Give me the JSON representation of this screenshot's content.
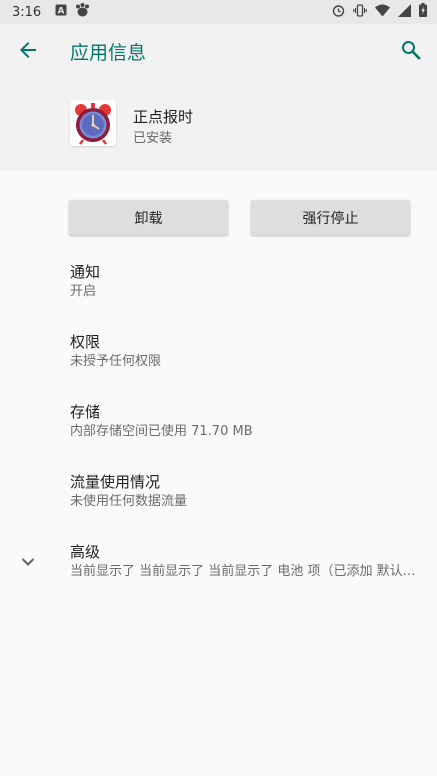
{
  "status_bar": {
    "time": "3:16",
    "left_icons": [
      "a-notification-icon",
      "paw-notification-icon"
    ],
    "right_icons": [
      "alarm-icon",
      "vibrate-icon",
      "wifi-icon",
      "signal-icon",
      "battery-icon"
    ]
  },
  "app_bar": {
    "title": "应用信息",
    "accent_color": "#00796b"
  },
  "app": {
    "name": "正点报时",
    "status": "已安装",
    "icon": "alarm-clock-icon"
  },
  "buttons": {
    "uninstall": "卸载",
    "force_stop": "强行停止"
  },
  "settings": [
    {
      "title": "通知",
      "summary": "开启"
    },
    {
      "title": "权限",
      "summary": "未授予任何权限"
    },
    {
      "title": "存储",
      "summary": "内部存储空间已使用 71.70 MB"
    },
    {
      "title": "流量使用情况",
      "summary": "未使用任何数据流量"
    },
    {
      "title": "高级",
      "summary": "当前显示了 当前显示了 当前显示了 电池 项（已添加 默认打开）"
    }
  ]
}
